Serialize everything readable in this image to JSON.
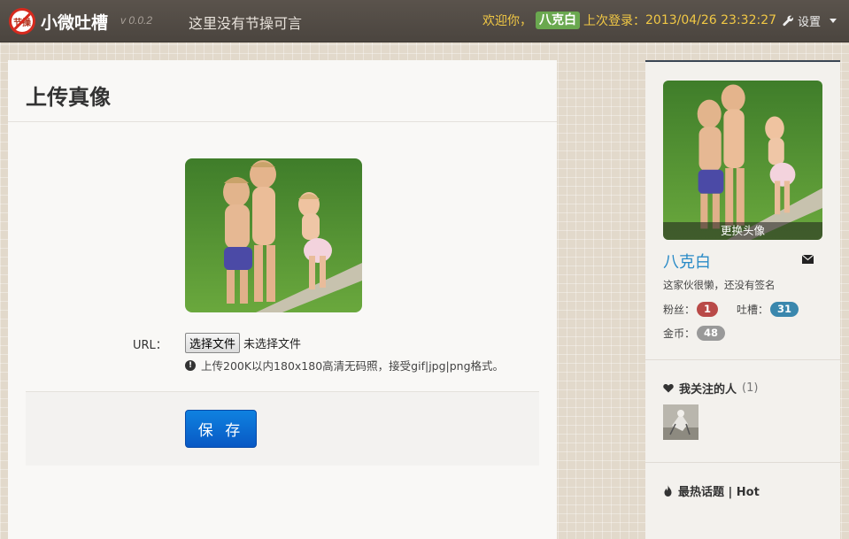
{
  "topbar": {
    "logo_text": "节操",
    "brand": "小微吐槽",
    "version": "v 0.0.2",
    "slogan": "这里没有节操可言",
    "welcome_prefix": "欢迎你，",
    "username": "八克白",
    "last_login_label": "上次登录：",
    "last_login_time": "2013/04/26 23:32:27",
    "settings_label": "设置"
  },
  "main": {
    "title": "上传真像",
    "url_label": "URL：",
    "file_button": "选择文件",
    "file_status": "未选择文件",
    "help_text": "上传200K以内180x180高清无码照，接受gif|jpg|png格式。",
    "save_label": "保 存"
  },
  "sidebar": {
    "change_avatar": "更换头像",
    "username": "八克白",
    "signature": "这家伙很懒，还没有签名",
    "fans_label": "粉丝：",
    "fans_count": "1",
    "tucao_label": "吐槽：",
    "tucao_count": "31",
    "coins_label": "金币：",
    "coins_count": "48",
    "following_title": "我关注的人",
    "following_count": "(1)",
    "hot_title": "最热话题 | Hot"
  },
  "colors": {
    "accent_blue": "#2a8bc7",
    "save_button": "#0a6cd6",
    "welcome_yellow": "#f1c845",
    "fans_badge": "#b94a48",
    "tucao_badge": "#3a87ad",
    "coins_badge": "#999999",
    "user_badge": "#6aa84f"
  },
  "icons": {
    "logo": "no-integrity-logo-icon",
    "settings": "wrench-icon",
    "dropdown": "caret-down-icon",
    "warning": "exclamation-circle-icon",
    "mail": "envelope-icon",
    "heart": "heart-icon",
    "fire": "fire-icon"
  }
}
